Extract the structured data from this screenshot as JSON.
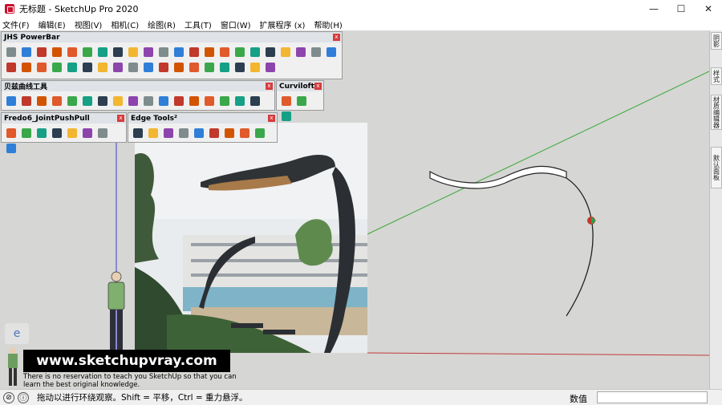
{
  "window": {
    "title": "无标题 - SketchUp Pro 2020",
    "minimize": "—",
    "maximize": "☐",
    "close": "✕"
  },
  "menus": [
    "文件(F)",
    "编辑(E)",
    "视图(V)",
    "相机(C)",
    "绘图(R)",
    "工具(T)",
    "窗口(W)",
    "扩展程序 (x)",
    "帮助(H)"
  ],
  "toolbars": {
    "jhs": {
      "title": "JHS PowerBar",
      "close": "x"
    },
    "bezier": {
      "title": "贝兹曲线工具",
      "close": "x"
    },
    "curviloft": {
      "title": "Curviloft",
      "close": "x"
    },
    "fredo": {
      "title": "Fredo6_JointPushPull",
      "close": "x"
    },
    "edge": {
      "title": "Edge Tools²",
      "close": "x"
    }
  },
  "right_tray": {
    "tabs": [
      "阴影",
      "样式",
      "材质编辑器",
      "默认面板"
    ]
  },
  "overlay": {
    "badge": "e",
    "website": "www.sketchupvray.com",
    "tagline": "There is no reservation to teach you SketchUp so that you can learn the best original knowledge."
  },
  "status": {
    "icons": [
      "⊘",
      "ⓘ"
    ],
    "hint": "拖动以进行环绕观察。Shift = 平移，Ctrl = 重力悬浮。",
    "measure_label": "数值",
    "measure_value": ""
  },
  "colors": {
    "canvas": "#d6d6d4",
    "axis_green": "#3aa83a",
    "axis_red": "#c03a3a",
    "axis_blue": "#3a3acc"
  }
}
